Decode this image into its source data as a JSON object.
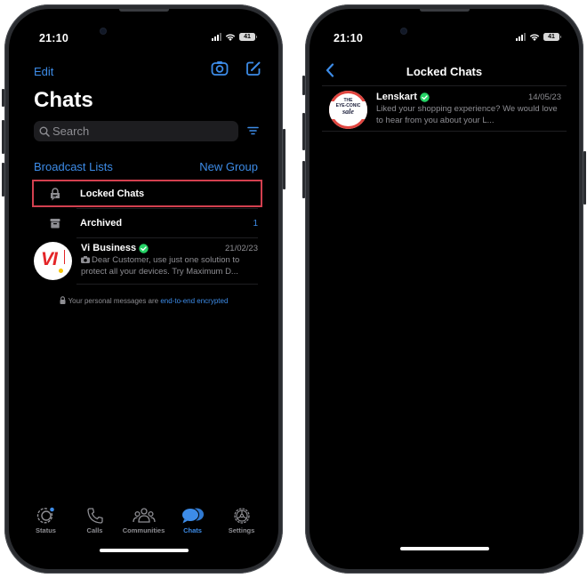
{
  "left_phone": {
    "status_bar": {
      "time": "21:10",
      "battery": "41"
    },
    "header": {
      "edit_label": "Edit",
      "camera_icon": "camera-icon",
      "compose_icon": "compose-icon"
    },
    "title": "Chats",
    "search": {
      "placeholder": "Search",
      "filter_icon": "filter-icon"
    },
    "links": {
      "broadcast": "Broadcast Lists",
      "new_group": "New Group"
    },
    "special_rows": [
      {
        "icon": "locked-chat-icon",
        "label": "Locked Chats",
        "count": "",
        "highlighted": true
      },
      {
        "icon": "archive-icon",
        "label": "Archived",
        "count": "1",
        "highlighted": false
      }
    ],
    "chats": [
      {
        "name": "Vi Business",
        "verified": true,
        "date": "21/02/23",
        "message": "Dear Customer, use just one solution to protect all your devices. Try Maximum D...",
        "message_icon": "photo-icon",
        "avatar_text": "VI"
      }
    ],
    "encryption": {
      "prefix": "Your personal messages are ",
      "link": "end-to-end encrypted"
    },
    "tabbar": [
      {
        "label": "Status",
        "icon": "status-icon",
        "active": false
      },
      {
        "label": "Calls",
        "icon": "phone-icon",
        "active": false
      },
      {
        "label": "Communities",
        "icon": "communities-icon",
        "active": false
      },
      {
        "label": "Chats",
        "icon": "chats-icon",
        "active": true
      },
      {
        "label": "Settings",
        "icon": "gear-icon",
        "active": false
      }
    ]
  },
  "right_phone": {
    "status_bar": {
      "time": "21:10",
      "battery": "41"
    },
    "nav": {
      "title": "Locked Chats",
      "back_icon": "chevron-left-icon"
    },
    "chats": [
      {
        "name": "Lenskart",
        "verified": true,
        "date": "14/05/23",
        "message": "Liked your shopping experience? We would love to hear from you about your L...",
        "avatar_text": [
          "THE",
          "EYE-CONIC",
          "sale"
        ]
      }
    ]
  },
  "colors": {
    "accent": "#3d8ce8",
    "verified": "#25d366",
    "highlight": "#d3404f",
    "vi_red": "#e42528",
    "vi_yellow": "#f5c400"
  }
}
